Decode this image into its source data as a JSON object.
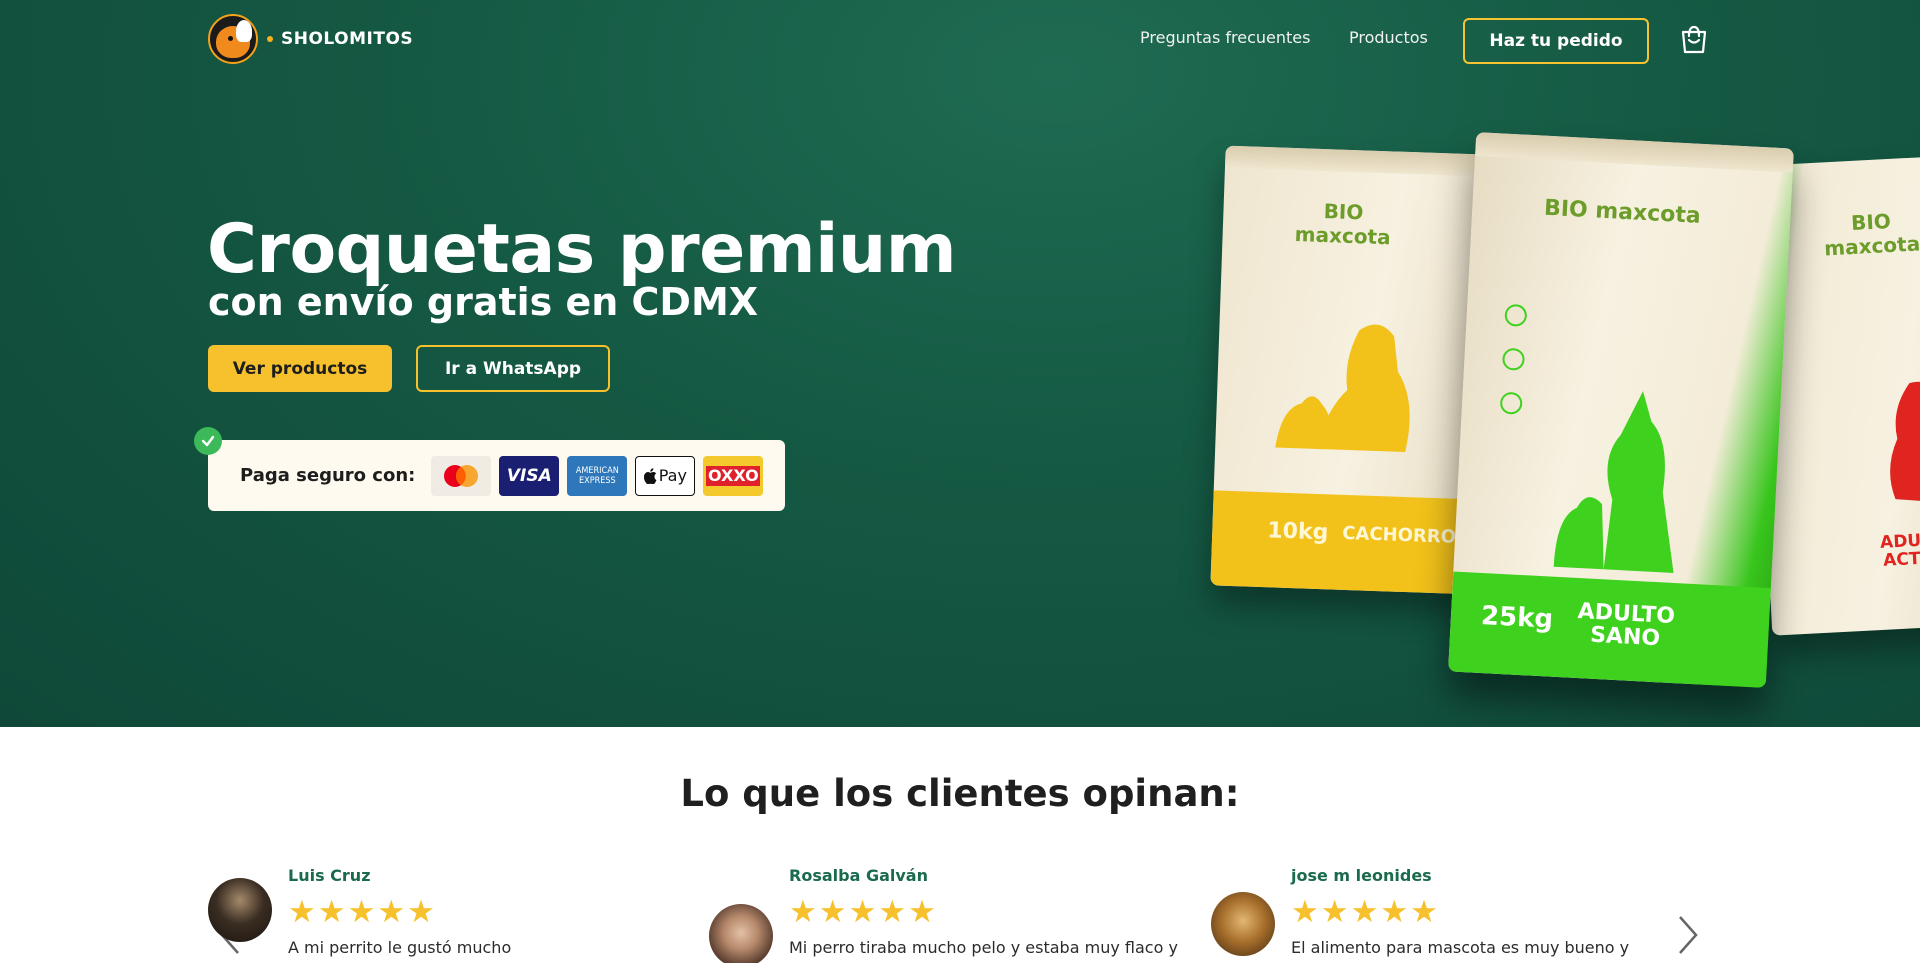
{
  "header": {
    "brand": "SHOLOMITOS",
    "nav": [
      {
        "label": "Preguntas frecuentes"
      },
      {
        "label": "Productos"
      }
    ],
    "order_button": "Haz tu pedido",
    "cart_icon": "shopping-bag-icon"
  },
  "hero": {
    "title": "Croquetas premium",
    "subtitle": "con envío gratis en CDMX",
    "primary_button": "Ver productos",
    "secondary_button": "Ir a WhatsApp",
    "payments": {
      "label": "Paga seguro con:",
      "methods": [
        "Mastercard",
        "VISA",
        "AMERICAN EXPRESS",
        "Pay",
        "OXXO"
      ]
    },
    "products": [
      {
        "brand": "BIO maxcota",
        "weight": "10kg",
        "name": "CACHORRO",
        "color": "#f2c21a"
      },
      {
        "brand": "BIO maxcota",
        "weight": "25kg",
        "name": "ADULTO SANO",
        "color": "#3ed11e"
      },
      {
        "brand": "BIO maxcota",
        "name": "ADULTO ACTIVO",
        "color": "#e0241f"
      }
    ]
  },
  "testimonials": {
    "title": "Lo que los clientes opinan:",
    "reviews": [
      {
        "name": "Luis Cruz",
        "stars": "★★★★★",
        "text": "A mi perrito le gustó mucho"
      },
      {
        "name": "Rosalba Galván",
        "stars": "★★★★★",
        "text": "Mi perro tiraba mucho pelo y estaba muy flaco y"
      },
      {
        "name": "jose m leonides",
        "stars": "★★★★★",
        "text": "El alimento para mascota es muy bueno y"
      }
    ]
  },
  "colors": {
    "accent_yellow": "#f6c12c",
    "hero_green": "#155a44",
    "name_green": "#1a6b4d"
  }
}
